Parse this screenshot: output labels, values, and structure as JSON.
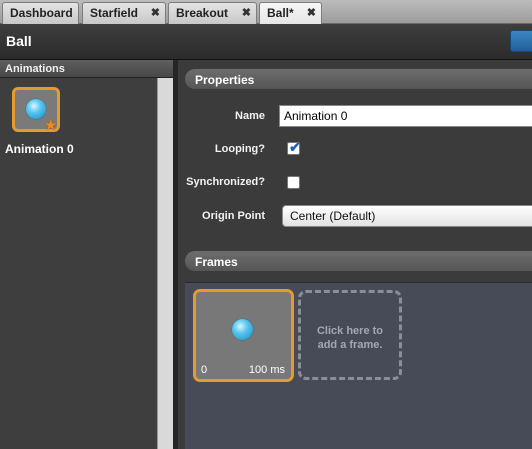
{
  "tabs": [
    {
      "label": "Dashboard",
      "closable": false,
      "active": false
    },
    {
      "label": "Starfield",
      "closable": true,
      "active": false
    },
    {
      "label": "Breakout",
      "closable": true,
      "active": false
    },
    {
      "label": "Ball*",
      "closable": true,
      "active": true
    }
  ],
  "close_glyph": "✖",
  "header": {
    "title": "Ball"
  },
  "animations": {
    "title": "Animations",
    "items": [
      {
        "label": "Animation 0",
        "icons": [
          "ball-icon",
          "star-icon"
        ]
      }
    ]
  },
  "properties": {
    "title": "Properties",
    "name_label": "Name",
    "name_value": "Animation 0",
    "looping_label": "Looping?",
    "looping_checked": true,
    "synchronized_label": "Synchronized?",
    "synchronized_checked": false,
    "origin_label": "Origin Point",
    "origin_value": "Center (Default)"
  },
  "frames": {
    "title": "Frames",
    "items": [
      {
        "index": "0",
        "duration": "100 ms"
      }
    ],
    "add_line1": "Click here to",
    "add_line2": "add a frame."
  },
  "colors": {
    "selection_orange": "#e39a2e",
    "accent_blue": "#2f79b8",
    "frames_bg": "#474b57"
  }
}
